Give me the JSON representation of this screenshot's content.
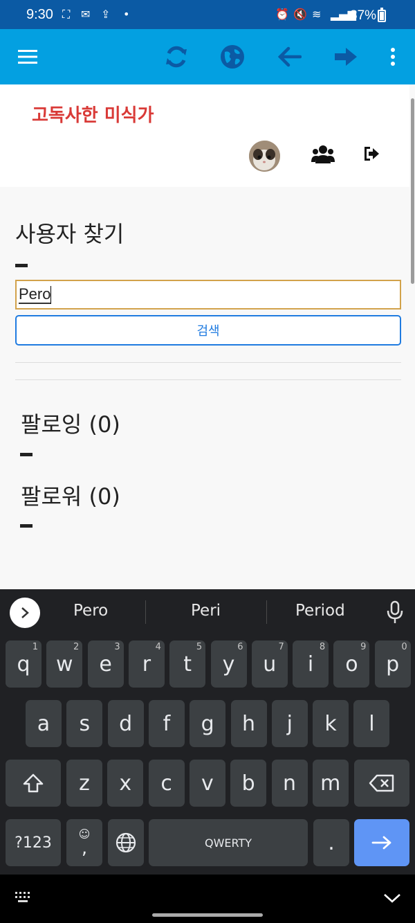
{
  "status_bar": {
    "time": "9:30",
    "battery": "87%",
    "battery_level": 0.87
  },
  "app_bar": {
    "icons": [
      "menu-icon",
      "refresh-icon",
      "globe-icon",
      "back-arrow-icon",
      "forward-arrow-icon",
      "more-vert-icon"
    ],
    "accent_color": "#03a0e1"
  },
  "header": {
    "site_title": "고독사한 미식가",
    "title_color": "#d93a37"
  },
  "search": {
    "heading": "사용자 찾기",
    "input_value": "Pero",
    "button_label": "검색"
  },
  "following": {
    "heading": "팔로잉 (0)"
  },
  "followers": {
    "heading": "팔로워 (0)"
  },
  "keyboard": {
    "suggestions": [
      "Pero",
      "Peri",
      "Period"
    ],
    "row1": [
      {
        "k": "q",
        "n": "1"
      },
      {
        "k": "w",
        "n": "2"
      },
      {
        "k": "e",
        "n": "3"
      },
      {
        "k": "r",
        "n": "4"
      },
      {
        "k": "t",
        "n": "5"
      },
      {
        "k": "y",
        "n": "6"
      },
      {
        "k": "u",
        "n": "7"
      },
      {
        "k": "i",
        "n": "8"
      },
      {
        "k": "o",
        "n": "9"
      },
      {
        "k": "p",
        "n": "0"
      }
    ],
    "row2": [
      "a",
      "s",
      "d",
      "f",
      "g",
      "h",
      "j",
      "k",
      "l"
    ],
    "row3": [
      "z",
      "x",
      "c",
      "v",
      "b",
      "n",
      "m"
    ],
    "symbols_label": "?123",
    "emoji_label": "☺",
    "comma_label": ",",
    "space_label": "QWERTY",
    "period_label": "."
  }
}
